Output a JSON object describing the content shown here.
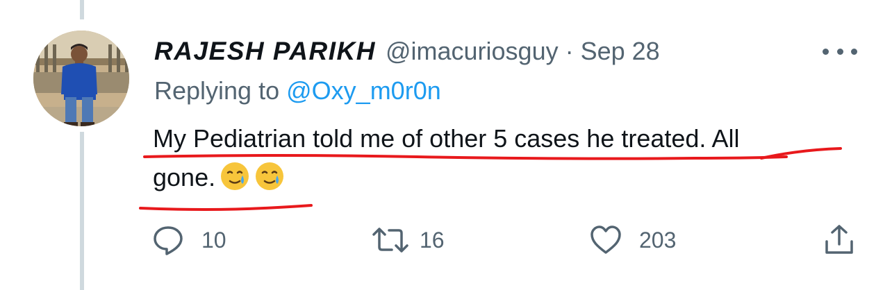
{
  "tweet": {
    "author_name": "RAJESH PARIKH",
    "handle": "@imacuriosguy",
    "separator": "·",
    "date": "Sep 28",
    "replying_prefix": "Replying to",
    "replying_to": "@Oxy_m0r0n",
    "text_line1": "My Pediatrian told me of other 5 cases he treated. All",
    "text_line2": "gone.",
    "emojis": [
      "smiling-face-with-tear",
      "smiling-face-with-tear"
    ]
  },
  "actions": {
    "reply_count": "10",
    "retweet_count": "16",
    "like_count": "203"
  },
  "colors": {
    "text": "#0f1419",
    "secondary": "#536471",
    "mention": "#1d9bf0",
    "annotation": "#e8191c",
    "thread_line": "#cfd9de"
  },
  "icons": [
    "more-icon",
    "reply-icon",
    "retweet-icon",
    "like-icon",
    "share-icon"
  ]
}
